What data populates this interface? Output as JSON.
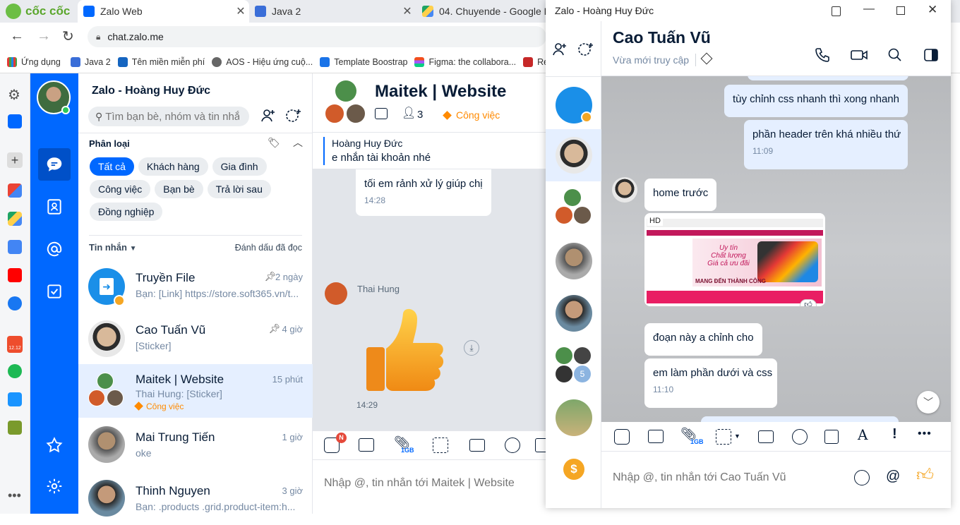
{
  "browser": {
    "tabs": [
      {
        "label": "Zalo Web",
        "active": true
      },
      {
        "label": "Java 2",
        "active": false
      },
      {
        "label": "04. Chuyende - Google D",
        "active": false
      }
    ],
    "browser_logo": "cốc cốc",
    "url": "chat.zalo.me",
    "bookmarks": [
      "Ứng dụng",
      "Java 2",
      "Tên miền miễn phí",
      "AOS - Hiệu ứng cuộ...",
      "Template Boostrap",
      "Figma: the collabora...",
      "Resp"
    ]
  },
  "sidebar": {
    "shop_badge": "12.12"
  },
  "contacts_panel": {
    "user_name": "Zalo - Hoàng Huy Đức",
    "search_placeholder": "Tìm bạn bè, nhóm và tin nhắn",
    "filter_title": "Phân loại",
    "filters": [
      "Tất cả",
      "Khách hàng",
      "Gia đình",
      "Công việc",
      "Bạn bè",
      "Trả lời sau",
      "Đồng nghiệp"
    ],
    "messages_label": "Tin nhắn",
    "mark_read": "Đánh dấu đã đọc",
    "conversations": [
      {
        "name": "Truyền File",
        "preview": "Bạn: [Link] https://store.soft365.vn/t...",
        "time": "2 ngày",
        "pinned": true
      },
      {
        "name": "Cao Tuấn Vũ",
        "preview": "[Sticker]",
        "time": "4 giờ",
        "pinned": true
      },
      {
        "name": "Maitek | Website",
        "preview": "Thai Hung: [Sticker]",
        "time": "15 phút",
        "tag": "Công việc",
        "selected": true
      },
      {
        "name": "Mai Trung Tiến",
        "preview": "oke",
        "time": "1 giờ"
      },
      {
        "name": "Thinh Nguyen",
        "preview": "Bạn: .products .grid.product-item:h...",
        "time": "3 giờ"
      }
    ]
  },
  "group_chat": {
    "title": "Maitek | Website",
    "member_count": "3",
    "tag": "Công việc",
    "pinned_sender": "Hoàng Huy Đức",
    "pinned_text": "e nhắn tài khoản nhé",
    "message1": "tối em rảnh xử lý giúp chị",
    "message1_time": "14:28",
    "sender2": "Thai Hung",
    "sticker_time": "14:29",
    "toolbar_badge": "N",
    "file_size_label": "1GB",
    "input_placeholder": "Nhập @, tin nhắn tới Maitek | Website"
  },
  "popup": {
    "window_title": "Zalo - Hoàng Huy Đức",
    "contact_name": "Cao Tuấn Vũ",
    "status": "Vừa mới truy cập",
    "group_count": "5",
    "messages": [
      {
        "text": "tùy chỉnh css nhanh thì xong nhanh",
        "mine": true
      },
      {
        "text": "phần header trên khá nhiều thứ",
        "time": "11:09",
        "mine": true
      },
      {
        "text": "home trước",
        "mine": false
      },
      {
        "text": "đoạn này a chỉnh cho",
        "mine": false
      },
      {
        "text": "em làm phần dưới và css",
        "time": "11:10",
        "mine": false
      }
    ],
    "image_label": "HD",
    "image_slogan": [
      "Uy tín",
      "Chất lượng",
      "Giá cả ưu đãi"
    ],
    "image_banner": "MANG ĐẾN THÀNH CÔNG",
    "file_size_label": "1GB",
    "input_placeholder": "Nhập @, tin nhắn tới Cao Tuấn Vũ"
  },
  "colors": {
    "zalo_blue": "#0068ff",
    "tag_orange": "#ff8a00",
    "bubble_mine": "#e5efff"
  }
}
